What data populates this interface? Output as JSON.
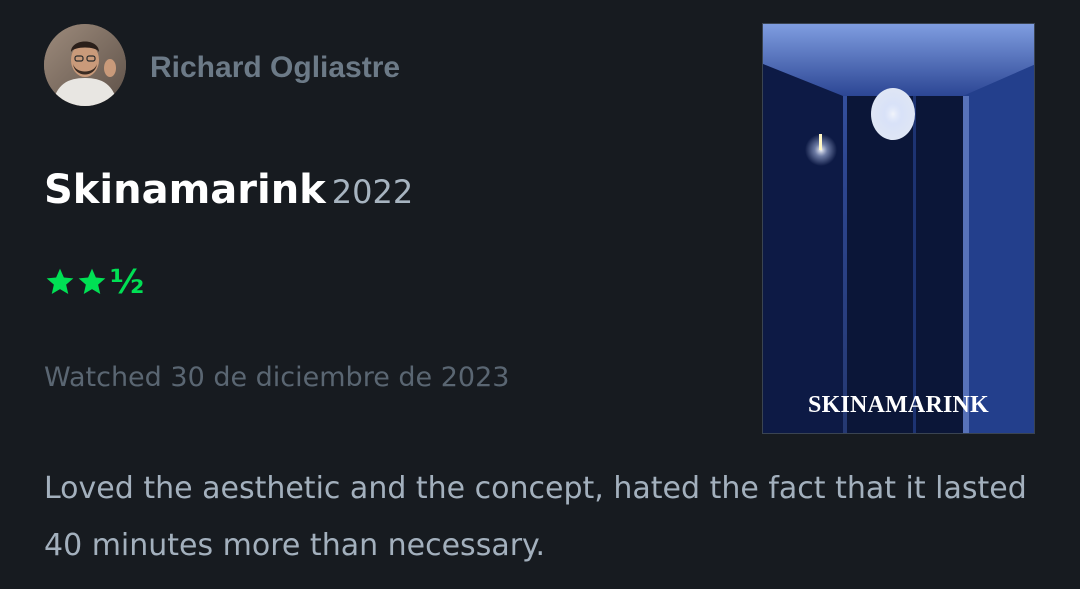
{
  "review": {
    "author": "Richard Ogliastre",
    "film": {
      "title": "Skinamarink",
      "year": "2022"
    },
    "rating": {
      "stars": 2.5,
      "max": 5,
      "half_glyph": "½",
      "color": "#00e054"
    },
    "watched": "Watched 30 de diciembre de 2023",
    "poster": {
      "title": "SKINAMARINK"
    },
    "body": "Loved the aesthetic and the concept, hated the fact that it lasted 40 minutes more than necessary."
  },
  "colors": {
    "background": "#171b20",
    "author": "#6c7a87",
    "year": "#a7b4c0",
    "watched": "#5a6672",
    "body_text": "#a3b0bd"
  },
  "icons": [
    "avatar",
    "star-icon"
  ]
}
